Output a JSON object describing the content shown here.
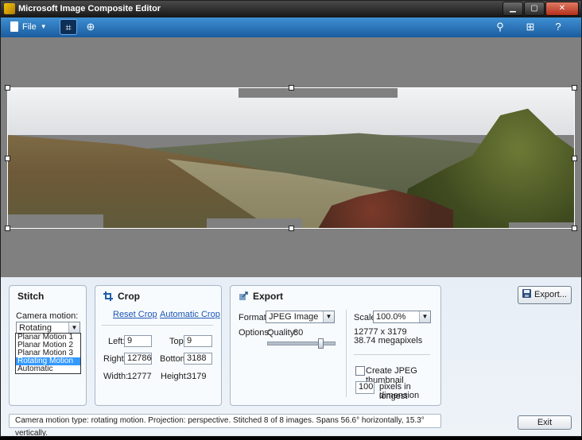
{
  "window": {
    "title": "Microsoft Image Composite Editor"
  },
  "menubar": {
    "file_label": "File"
  },
  "stitch": {
    "title": "Stitch",
    "camera_motion_label": "Camera motion:",
    "camera_motion_value": "Rotating Motion",
    "options": [
      "Planar Motion 1",
      "Planar Motion 2",
      "Planar Motion 3",
      "Rotating Motion",
      "Automatic"
    ]
  },
  "crop": {
    "title": "Crop",
    "reset_link": "Reset Crop",
    "auto_link": "Automatic Crop",
    "left_label": "Left:",
    "left_value": "9",
    "top_label": "Top:",
    "top_value": "9",
    "right_label": "Right:",
    "right_value": "12786",
    "bottom_label": "Bottom:",
    "bottom_value": "3188",
    "width_label": "Width:",
    "width_value": "12777",
    "height_label": "Height:",
    "height_value": "3179"
  },
  "export": {
    "title": "Export",
    "format_label": "Format:",
    "format_value": "JPEG Image",
    "options_label": "Options:",
    "quality_label": "Quality:",
    "quality_value": "80",
    "quality_fraction": 0.8,
    "scale_label": "Scale:",
    "scale_value": "100.0%",
    "dimensions": "12777 x 3179",
    "megapixels": "38.74 megapixels",
    "thumbnail_label": "Create JPEG thumbnail",
    "thumbnail_checked": false,
    "thumb_size_value": "100",
    "thumb_size_label_1": "pixels in longest",
    "thumb_size_label_2": "dimension"
  },
  "buttons": {
    "export_label": "Export...",
    "exit_label": "Exit"
  },
  "status": {
    "text": "Camera motion type: rotating motion. Projection: perspective. Stitched 8 of 8 images. Spans 56.6° horizontally, 15.3° vertically."
  },
  "icons": {
    "app": "image-composite-app-icon",
    "file": "document-icon",
    "crop_tool": "crop-tool-icon",
    "projection_tool": "globe-icon",
    "zoom": "magnifier-icon",
    "fit": "fit-to-window-icon",
    "help": "help-icon",
    "stitch": "stitch-icon",
    "crop": "crop-icon",
    "export": "export-icon",
    "save": "floppy-disk-icon"
  },
  "colors": {
    "menubar": "#1f6cb4",
    "selection": "#3399ff",
    "link": "#1a55b5",
    "canvas": "#808080"
  }
}
